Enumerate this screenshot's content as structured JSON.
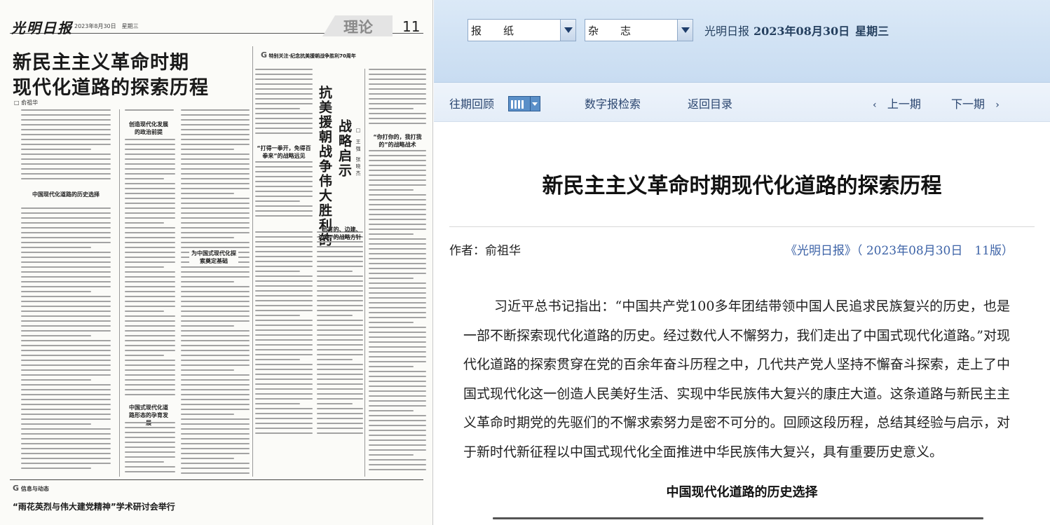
{
  "newspaper_page": {
    "masthead_logo": "光明日报",
    "masthead_meta": "2023年8月30日　星期三",
    "section_tag": "理论",
    "page_number": "11",
    "headline_line1": "新民主主义革命时期",
    "headline_line2": "现代化道路的探索历程",
    "headline_author": "俞祖华",
    "feature_banner": "特别关注·纪念抗美援朝战争胜利70周年",
    "feature_headline_line1": "抗美援朝战争伟大胜利的",
    "feature_headline_line2": "战略启示",
    "subheads": [
      "创造现代化发展的政治前提",
      "中国现代化道路的历史选择",
      "中国式现代化道路形态的孕育发展",
      "为中国式现代化探索奠定基础",
      "“打得一拳开，免得百拳来”的战略远见",
      "“出打的、边建、边建”的战略方针",
      "“你打你的，我打我的”的战略战术"
    ],
    "info_label": "信息与动态",
    "info_title": "“雨花英烈与伟大建党精神”学术研讨会举行"
  },
  "topbar": {
    "select_newspaper": "报　纸",
    "select_magazine": "杂　志",
    "paper_name": "光明日报",
    "date": "2023年08月30日",
    "weekday": "星期三"
  },
  "nav": {
    "past_issues": "往期回顾",
    "digital_search": "数字报检索",
    "back_to_index": "返回目录",
    "prev_issue": "上一期",
    "next_issue": "下一期"
  },
  "article": {
    "title": "新民主主义革命时期现代化道路的探索历程",
    "author_label": "作者：",
    "author": "俞祖华",
    "source": "《光明日报》（ 2023年08月30日　11版）",
    "paragraph": "习近平总书记指出：“中国共产党100多年团结带领中国人民追求民族复兴的历史，也是一部不断探索现代化道路的历史。经过数代人不懈努力，我们走出了中国式现代化道路。”对现代化道路的探索贯穿在党的百余年奋斗历程之中，几代共产党人坚持不懈奋斗探索，走上了中国式现代化这一创造人民美好生活、实现中华民族伟大复兴的康庄大道。这条道路与新民主主义革命时期党的先驱们的不懈求索努力是密不可分的。回顾这段历程，总结其经验与启示，对于新时代新征程以中国式现代化全面推进中华民族伟大复兴，具有重要历史意义。",
    "subtitle": "中国现代化道路的历史选择"
  }
}
